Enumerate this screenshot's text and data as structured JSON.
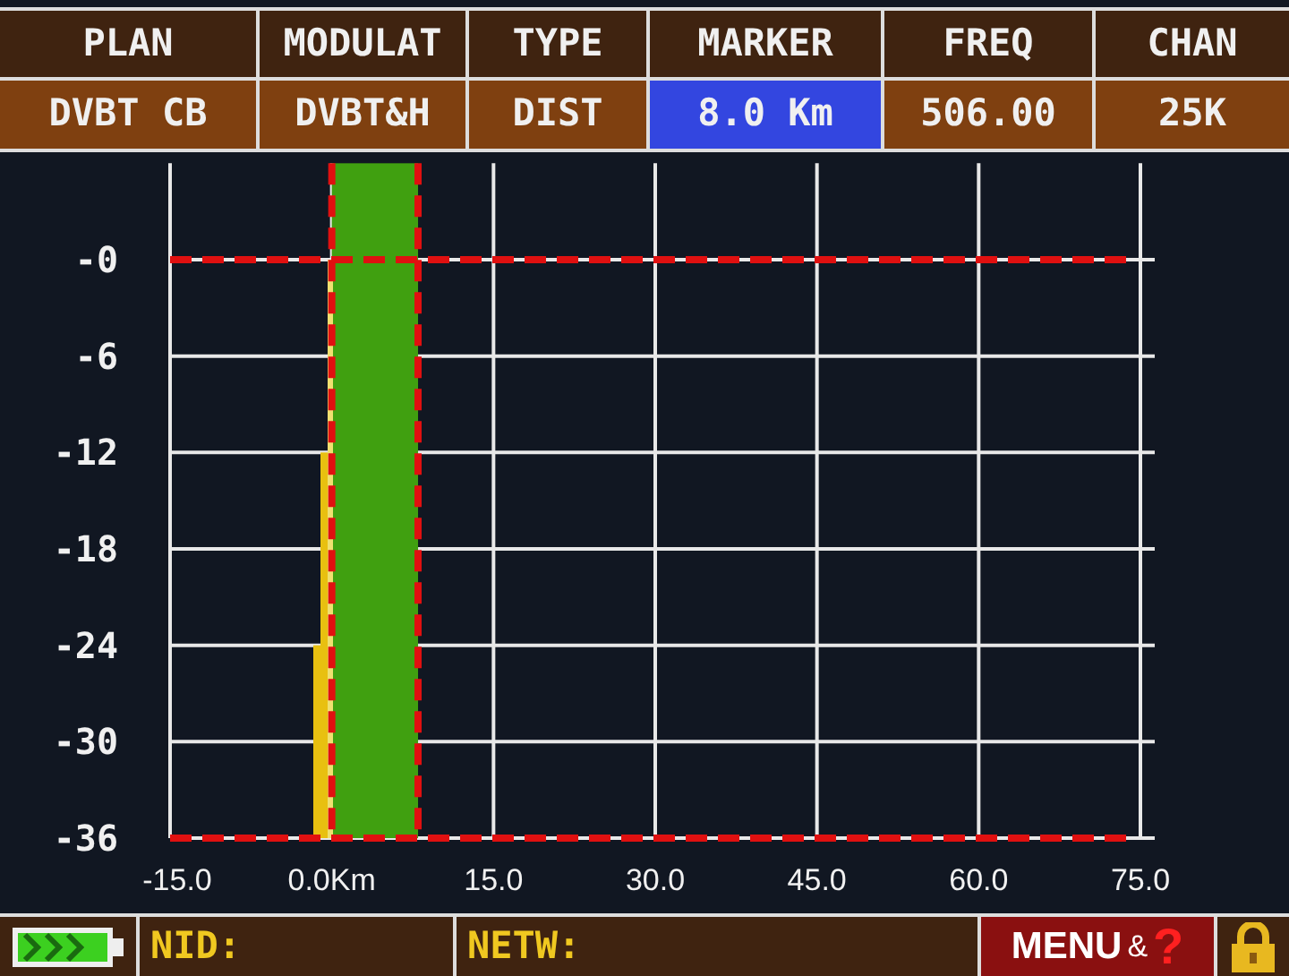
{
  "header": {
    "columns": [
      {
        "label": "PLAN",
        "value": "DVBT CB",
        "selected": false
      },
      {
        "label": "MODULAT",
        "value": "DVBT&H",
        "selected": false
      },
      {
        "label": "TYPE",
        "value": "DIST",
        "selected": false
      },
      {
        "label": "MARKER",
        "value": "8.0 Km",
        "selected": true
      },
      {
        "label": "FREQ",
        "value": "506.00",
        "selected": false
      },
      {
        "label": "CHAN",
        "value": "25K",
        "selected": false
      }
    ]
  },
  "chart": {
    "chart_data": {
      "type": "bar",
      "xlim": [
        -15,
        75
      ],
      "ylim": [
        -36,
        6
      ],
      "xticks": [
        {
          "value": -15,
          "label": "-15.0"
        },
        {
          "value": 0,
          "label": "0.0Km"
        },
        {
          "value": 15,
          "label": "15.0"
        },
        {
          "value": 30,
          "label": "30.0"
        },
        {
          "value": 45,
          "label": "45.0"
        },
        {
          "value": 60,
          "label": "60.0"
        },
        {
          "value": 75,
          "label": "75.0"
        }
      ],
      "yticks": [
        {
          "value": 0,
          "label": "-0"
        },
        {
          "value": -6,
          "label": "-6"
        },
        {
          "value": -12,
          "label": "-12"
        },
        {
          "value": -18,
          "label": "-18"
        },
        {
          "value": -24,
          "label": "-24"
        },
        {
          "value": -30,
          "label": "-30"
        },
        {
          "value": -36,
          "label": "-36"
        }
      ],
      "grid": true,
      "bands": [
        {
          "axis": "x",
          "from": 0,
          "to": 8,
          "color": "#40a010"
        }
      ]
    }
  },
  "footer": {
    "nid_label": "NID:",
    "netw_label": "NETW:",
    "menu": {
      "label": "MENU",
      "amp": "&",
      "help": "?"
    }
  }
}
